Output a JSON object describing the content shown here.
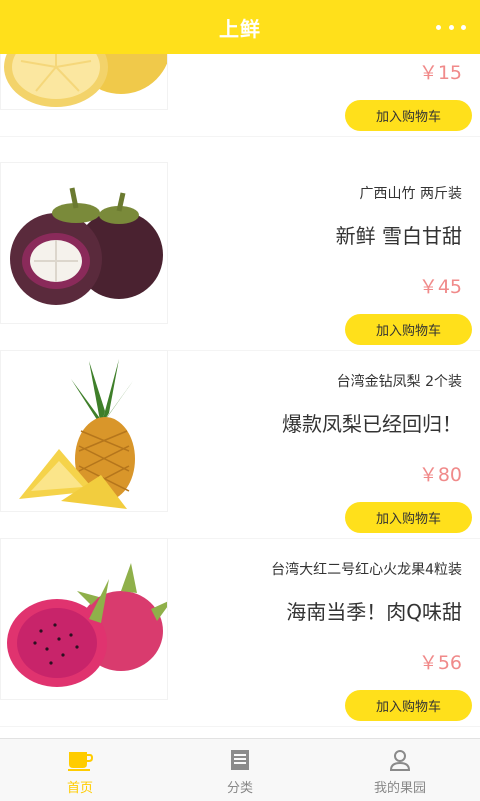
{
  "header": {
    "title": "上鲜"
  },
  "products": [
    {
      "name": "",
      "desc": "",
      "price": "￥15",
      "button": "加入购物车"
    },
    {
      "name": "广西山竹 两斤装",
      "desc": "新鲜 雪白甘甜",
      "price": "￥45",
      "button": "加入购物车"
    },
    {
      "name": "台湾金钻凤梨 2个装",
      "desc": "爆款凤梨已经回归！",
      "price": "￥80",
      "button": "加入购物车"
    },
    {
      "name": "台湾大红二号红心火龙果4粒装",
      "desc": "海南当季！肉Q味甜",
      "price": "￥56",
      "button": "加入购物车"
    }
  ],
  "tabbar": {
    "tabs": [
      {
        "label": "首页",
        "icon": "cup-icon",
        "active": true
      },
      {
        "label": "分类",
        "icon": "list-icon",
        "active": false
      },
      {
        "label": "我的果园",
        "icon": "user-icon",
        "active": false
      }
    ]
  },
  "colors": {
    "accent": "#ffe01b",
    "price": "#f08a8a",
    "tab_active": "#ffcc00"
  }
}
